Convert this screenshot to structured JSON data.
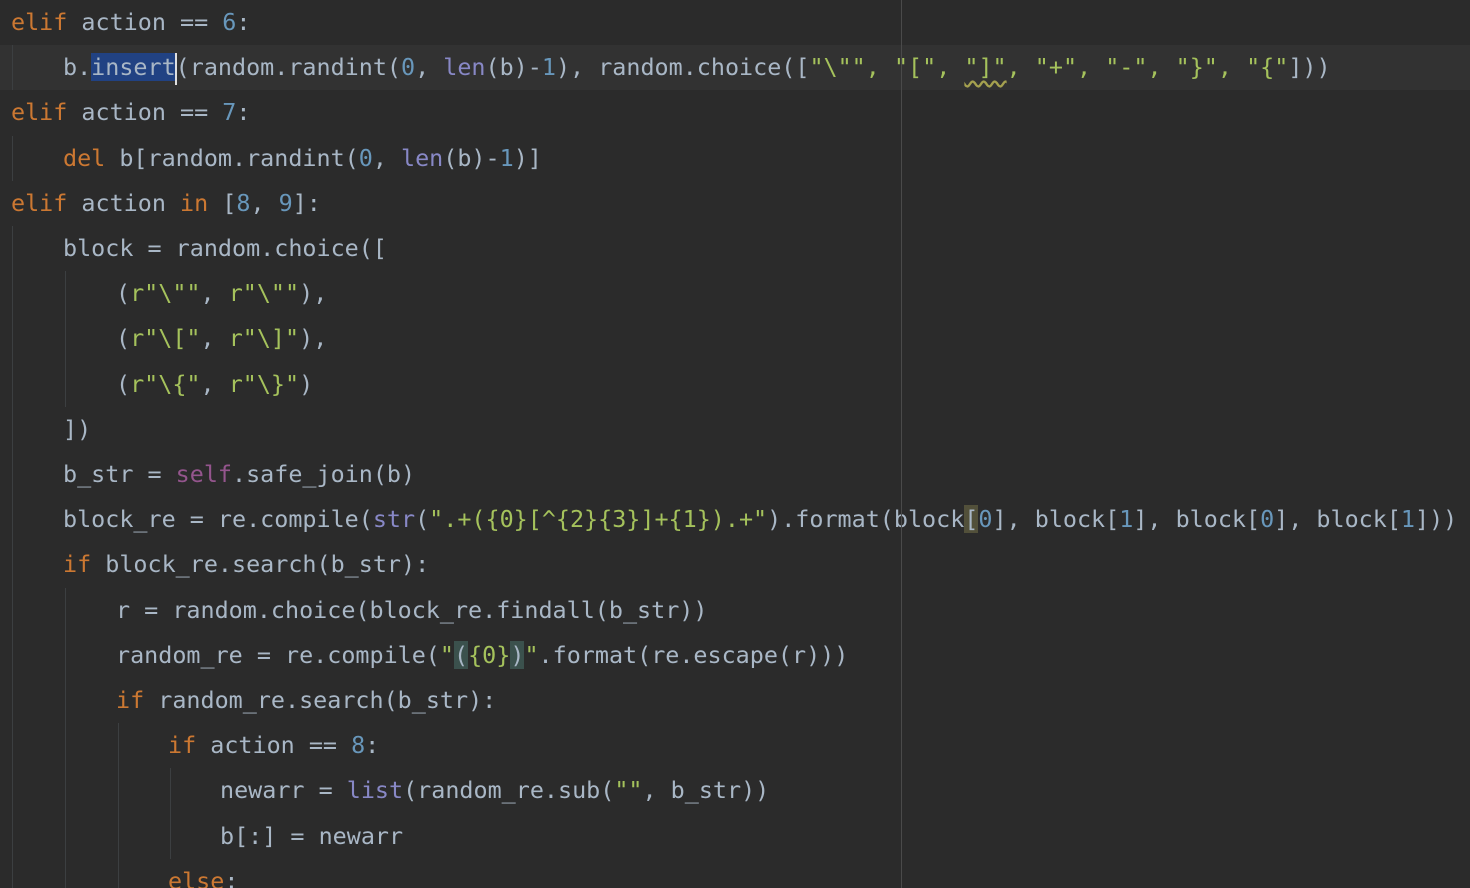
{
  "editor": {
    "language": "python",
    "colors": {
      "background": "#2b2b2b",
      "current_line": "#323232",
      "selection": "#214283",
      "keyword": "#cc7832",
      "number": "#6897bb",
      "string": "#a5c25c",
      "builtin": "#8888c6",
      "self": "#94558d",
      "default_text": "#a9b7c6"
    },
    "selected_text": "insert",
    "lines": [
      [
        [
          "kw",
          "elif"
        ],
        [
          "t",
          " action == "
        ],
        [
          "num",
          "6"
        ],
        [
          "t",
          ":"
        ]
      ],
      [
        [
          "t",
          "b."
        ],
        [
          "sel",
          "insert"
        ],
        [
          "caret",
          ""
        ],
        [
          "t",
          "(random.randint("
        ],
        [
          "num",
          "0"
        ],
        [
          "t",
          ", "
        ],
        [
          "bi",
          "len"
        ],
        [
          "t",
          "(b)-"
        ],
        [
          "num",
          "1"
        ],
        [
          "t",
          "), random.choice(["
        ],
        [
          "str",
          "\"\\\"\""
        ],
        [
          "str",
          ", "
        ],
        [
          "str",
          "\"[\""
        ],
        [
          "str",
          ", "
        ],
        [
          "warn",
          "\"]\""
        ],
        [
          "str",
          ", "
        ],
        [
          "str",
          "\"+\""
        ],
        [
          "str",
          ", "
        ],
        [
          "str",
          "\"-\""
        ],
        [
          "str",
          ", "
        ],
        [
          "str",
          "\"}\""
        ],
        [
          "str",
          ", "
        ],
        [
          "str",
          "\"{\""
        ],
        [
          "t",
          "]))"
        ]
      ],
      [
        [
          "kw",
          "elif"
        ],
        [
          "t",
          " action == "
        ],
        [
          "num",
          "7"
        ],
        [
          "t",
          ":"
        ]
      ],
      [
        [
          "kw",
          "del"
        ],
        [
          "t",
          " b[random.randint("
        ],
        [
          "num",
          "0"
        ],
        [
          "t",
          ", "
        ],
        [
          "bi",
          "len"
        ],
        [
          "t",
          "(b)-"
        ],
        [
          "num",
          "1"
        ],
        [
          "t",
          ")]"
        ]
      ],
      [
        [
          "kw",
          "elif"
        ],
        [
          "t",
          " action "
        ],
        [
          "kw",
          "in"
        ],
        [
          "t",
          " ["
        ],
        [
          "num",
          "8"
        ],
        [
          "t",
          ", "
        ],
        [
          "num",
          "9"
        ],
        [
          "t",
          "]:"
        ]
      ],
      [
        [
          "t",
          "block = random.choice(["
        ]
      ],
      [
        [
          "t",
          "("
        ],
        [
          "str",
          "r\"\\\"\""
        ],
        [
          "t",
          ", "
        ],
        [
          "str",
          "r\"\\\"\""
        ],
        [
          "t",
          "),"
        ]
      ],
      [
        [
          "t",
          "("
        ],
        [
          "str",
          "r\"\\[\""
        ],
        [
          "t",
          ", "
        ],
        [
          "str",
          "r\"\\]\""
        ],
        [
          "t",
          "),"
        ]
      ],
      [
        [
          "t",
          "("
        ],
        [
          "str",
          "r\"\\{\""
        ],
        [
          "t",
          ", "
        ],
        [
          "str",
          "r\"\\}\""
        ],
        [
          "t",
          ")"
        ]
      ],
      [
        [
          "t",
          "])"
        ]
      ],
      [
        [
          "t",
          "b_str = "
        ],
        [
          "self",
          "self"
        ],
        [
          "t",
          ".safe_join(b)"
        ]
      ],
      [
        [
          "t",
          "block_re = re.compile("
        ],
        [
          "bi",
          "str"
        ],
        [
          "t",
          "("
        ],
        [
          "str",
          "\".+({0}[^{2}{3}]+{1}).+\""
        ],
        [
          "t",
          ").format(block"
        ],
        [
          "hlm",
          "["
        ],
        [
          "num",
          "0"
        ],
        [
          "t",
          "], block["
        ],
        [
          "num",
          "1"
        ],
        [
          "t",
          "], block["
        ],
        [
          "num",
          "0"
        ],
        [
          "t",
          "], block["
        ],
        [
          "num",
          "1"
        ],
        [
          "t",
          "]))"
        ]
      ],
      [
        [
          "kw",
          "if"
        ],
        [
          "t",
          " block_re.search(b_str):"
        ]
      ],
      [
        [
          "t",
          "r = random.choice(block_re.findall(b_str))"
        ]
      ],
      [
        [
          "t",
          "random_re = re.compile("
        ],
        [
          "str",
          "\""
        ],
        [
          "hlb",
          "("
        ],
        [
          "str",
          "{0}"
        ],
        [
          "hlb",
          ")"
        ],
        [
          "str",
          "\""
        ],
        [
          "t",
          ".format(re.escape(r)))"
        ]
      ],
      [
        [
          "kw",
          "if"
        ],
        [
          "t",
          " random_re.search(b_str):"
        ]
      ],
      [
        [
          "kw",
          "if"
        ],
        [
          "t",
          " action == "
        ],
        [
          "num",
          "8"
        ],
        [
          "t",
          ":"
        ]
      ],
      [
        [
          "t",
          "newarr = "
        ],
        [
          "bi",
          "list"
        ],
        [
          "t",
          "(random_re.sub("
        ],
        [
          "str",
          "\"\""
        ],
        [
          "t",
          ", b_str))"
        ]
      ],
      [
        [
          "t",
          "b[:] = newarr"
        ]
      ],
      [
        [
          "kw",
          "else"
        ],
        [
          "t",
          ":"
        ]
      ]
    ]
  }
}
